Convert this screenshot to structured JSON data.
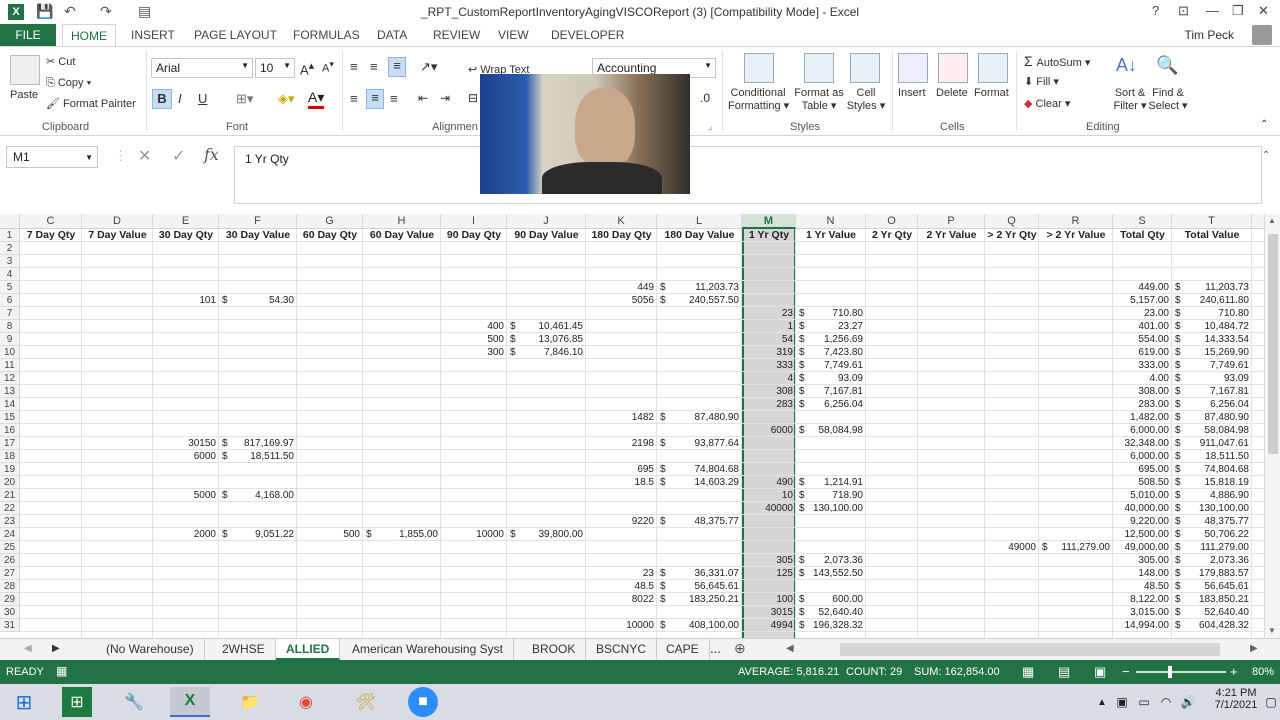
{
  "window": {
    "title": "_RPT_CustomReportInventoryAgingVISCOReport (3)  [Compatibility Mode] - Excel",
    "help": "?",
    "minimize": "—",
    "restore": "❐",
    "close": "✕"
  },
  "ribbon_tabs": [
    "FILE",
    "HOME",
    "INSERT",
    "PAGE LAYOUT",
    "FORMULAS",
    "DATA",
    "REVIEW",
    "VIEW",
    "DEVELOPER"
  ],
  "user": "Tim Peck",
  "ribbon": {
    "paste": "Paste",
    "cut": "Cut",
    "copy": "Copy",
    "format_painter": "Format Painter",
    "clipboard_label": "Clipboard",
    "font_name": "Arial",
    "font_size": "10",
    "bold": "B",
    "italic": "I",
    "underline": "U",
    "font_label": "Font",
    "wrap_text": "Wrap Text",
    "alignment_label": "Alignmen",
    "number_format": "Accounting",
    "conditional_formatting": [
      "Conditional",
      "Formatting"
    ],
    "format_as_table": [
      "Format as",
      "Table"
    ],
    "cell_styles": [
      "Cell",
      "Styles"
    ],
    "styles_label": "Styles",
    "insert": "Insert",
    "delete": "Delete",
    "format": "Format",
    "cells_label": "Cells",
    "autosum": "AutoSum",
    "fill": "Fill",
    "clear": "Clear",
    "sort_filter": [
      "Sort &",
      "Filter"
    ],
    "find_select": [
      "Find &",
      "Select"
    ],
    "editing_label": "Editing"
  },
  "formula_bar": {
    "name_box": "M1",
    "fx": "fx",
    "content": "1 Yr Qty"
  },
  "grid": {
    "columns": [
      "C",
      "D",
      "E",
      "F",
      "G",
      "H",
      "I",
      "J",
      "K",
      "L",
      "M",
      "N",
      "O",
      "P",
      "Q",
      "R",
      "S",
      "T"
    ],
    "headers": [
      "7 Day Qty",
      "7 Day Value",
      "30 Day Qty",
      "30 Day Value",
      "60 Day Qty",
      "60 Day Value",
      "90 Day Qty",
      "90 Day Value",
      "180 Day Qty",
      "180 Day Value",
      "1 Yr Qty",
      "1 Yr Value",
      "2 Yr Qty",
      "2 Yr Value",
      "> 2 Yr Qty",
      "> 2 Yr Value",
      "Total Qty",
      "Total Value"
    ],
    "selected_column": "M",
    "rows": [
      {
        "r": "2"
      },
      {
        "r": "3"
      },
      {
        "r": "4"
      },
      {
        "r": "5",
        "K": "449",
        "L": "11,203.73",
        "S": "449.00",
        "T": "11,203.73"
      },
      {
        "r": "6",
        "E": "101",
        "F": "54.30",
        "K": "5056",
        "L": "240,557.50",
        "S": "5,157.00",
        "T": "240,611.80"
      },
      {
        "r": "7",
        "M": "23",
        "N": "710.80",
        "S": "23.00",
        "T": "710.80"
      },
      {
        "r": "8",
        "I": "400",
        "J": "10,461.45",
        "M": "1",
        "N": "23.27",
        "S": "401.00",
        "T": "10,484.72"
      },
      {
        "r": "9",
        "I": "500",
        "J": "13,076.85",
        "M": "54",
        "N": "1,256.69",
        "S": "554.00",
        "T": "14,333.54"
      },
      {
        "r": "10",
        "I": "300",
        "J": "7,846.10",
        "M": "319",
        "N": "7,423.80",
        "S": "619.00",
        "T": "15,269.90"
      },
      {
        "r": "11",
        "M": "333",
        "N": "7,749.61",
        "S": "333.00",
        "T": "7,749.61"
      },
      {
        "r": "12",
        "M": "4",
        "N": "93.09",
        "S": "4.00",
        "T": "93.09"
      },
      {
        "r": "13",
        "M": "308",
        "N": "7,167.81",
        "S": "308.00",
        "T": "7,167.81"
      },
      {
        "r": "14",
        "M": "283",
        "N": "6,256.04",
        "S": "283.00",
        "T": "6,256.04"
      },
      {
        "r": "15",
        "K": "1482",
        "L": "87,480.90",
        "S": "1,482.00",
        "T": "87,480.90"
      },
      {
        "r": "16",
        "M": "6000",
        "N": "58,084.98",
        "S": "6,000.00",
        "T": "58,084.98"
      },
      {
        "r": "17",
        "E": "30150",
        "F": "817,169.97",
        "K": "2198",
        "L": "93,877.64",
        "S": "32,348.00",
        "T": "911,047.61"
      },
      {
        "r": "18",
        "E": "6000",
        "F": "18,511.50",
        "S": "6,000.00",
        "T": "18,511.50"
      },
      {
        "r": "19",
        "K": "695",
        "L": "74,804.68",
        "S": "695.00",
        "T": "74,804.68"
      },
      {
        "r": "20",
        "K": "18.5",
        "L": "14,603.29",
        "M": "490",
        "N": "1,214.91",
        "S": "508.50",
        "T": "15,818.19"
      },
      {
        "r": "21",
        "E": "5000",
        "F": "4,168.00",
        "M": "10",
        "N": "718.90",
        "S": "5,010.00",
        "T": "4,886.90"
      },
      {
        "r": "22",
        "M": "40000",
        "N": "130,100.00",
        "S": "40,000.00",
        "T": "130,100.00"
      },
      {
        "r": "23",
        "K": "9220",
        "L": "48,375.77",
        "S": "9,220.00",
        "T": "48,375.77"
      },
      {
        "r": "24",
        "E": "2000",
        "F": "9,051.22",
        "G": "500",
        "H": "1,855.00",
        "I": "10000",
        "J": "39,800.00",
        "S": "12,500.00",
        "T": "50,706.22"
      },
      {
        "r": "25",
        "Q": "49000",
        "R": "111,279.00",
        "S": "49,000.00",
        "T": "111,279.00"
      },
      {
        "r": "26",
        "M": "305",
        "N": "2,073.36",
        "S": "305.00",
        "T": "2,073.36"
      },
      {
        "r": "27",
        "K": "23",
        "L": "36,331.07",
        "M": "125",
        "N": "143,552.50",
        "S": "148.00",
        "T": "179,883.57"
      },
      {
        "r": "28",
        "K": "48.5",
        "L": "56,645.61",
        "S": "48.50",
        "T": "56,645.61"
      },
      {
        "r": "29",
        "K": "8022",
        "L": "183,250.21",
        "M": "100",
        "N": "600.00",
        "S": "8,122.00",
        "T": "183,850.21"
      },
      {
        "r": "30",
        "M": "3015",
        "N": "52,640.40",
        "S": "3,015.00",
        "T": "52,640.40"
      },
      {
        "r": "31",
        "K": "10000",
        "L": "408,100.00",
        "M": "4994",
        "N": "196,328.32",
        "S": "14,994.00",
        "T": "604,428.32"
      }
    ]
  },
  "sheet_tabs": [
    "(No Warehouse)",
    "2WHSE",
    "ALLIED",
    "American Warehousing Syst",
    "BROOK",
    "BSCNYC",
    "CAPE"
  ],
  "active_sheet": "ALLIED",
  "sheet_more": "...",
  "status": {
    "ready": "READY",
    "average": "AVERAGE: 5,816.21",
    "count": "COUNT: 29",
    "sum": "SUM: 162,854.00",
    "zoom": "80%"
  },
  "taskbar": {
    "time": "4:21 PM",
    "date": "7/1/2021"
  },
  "colors": {
    "excel_green": "#217346",
    "selected_column": "#d6d6d6"
  }
}
